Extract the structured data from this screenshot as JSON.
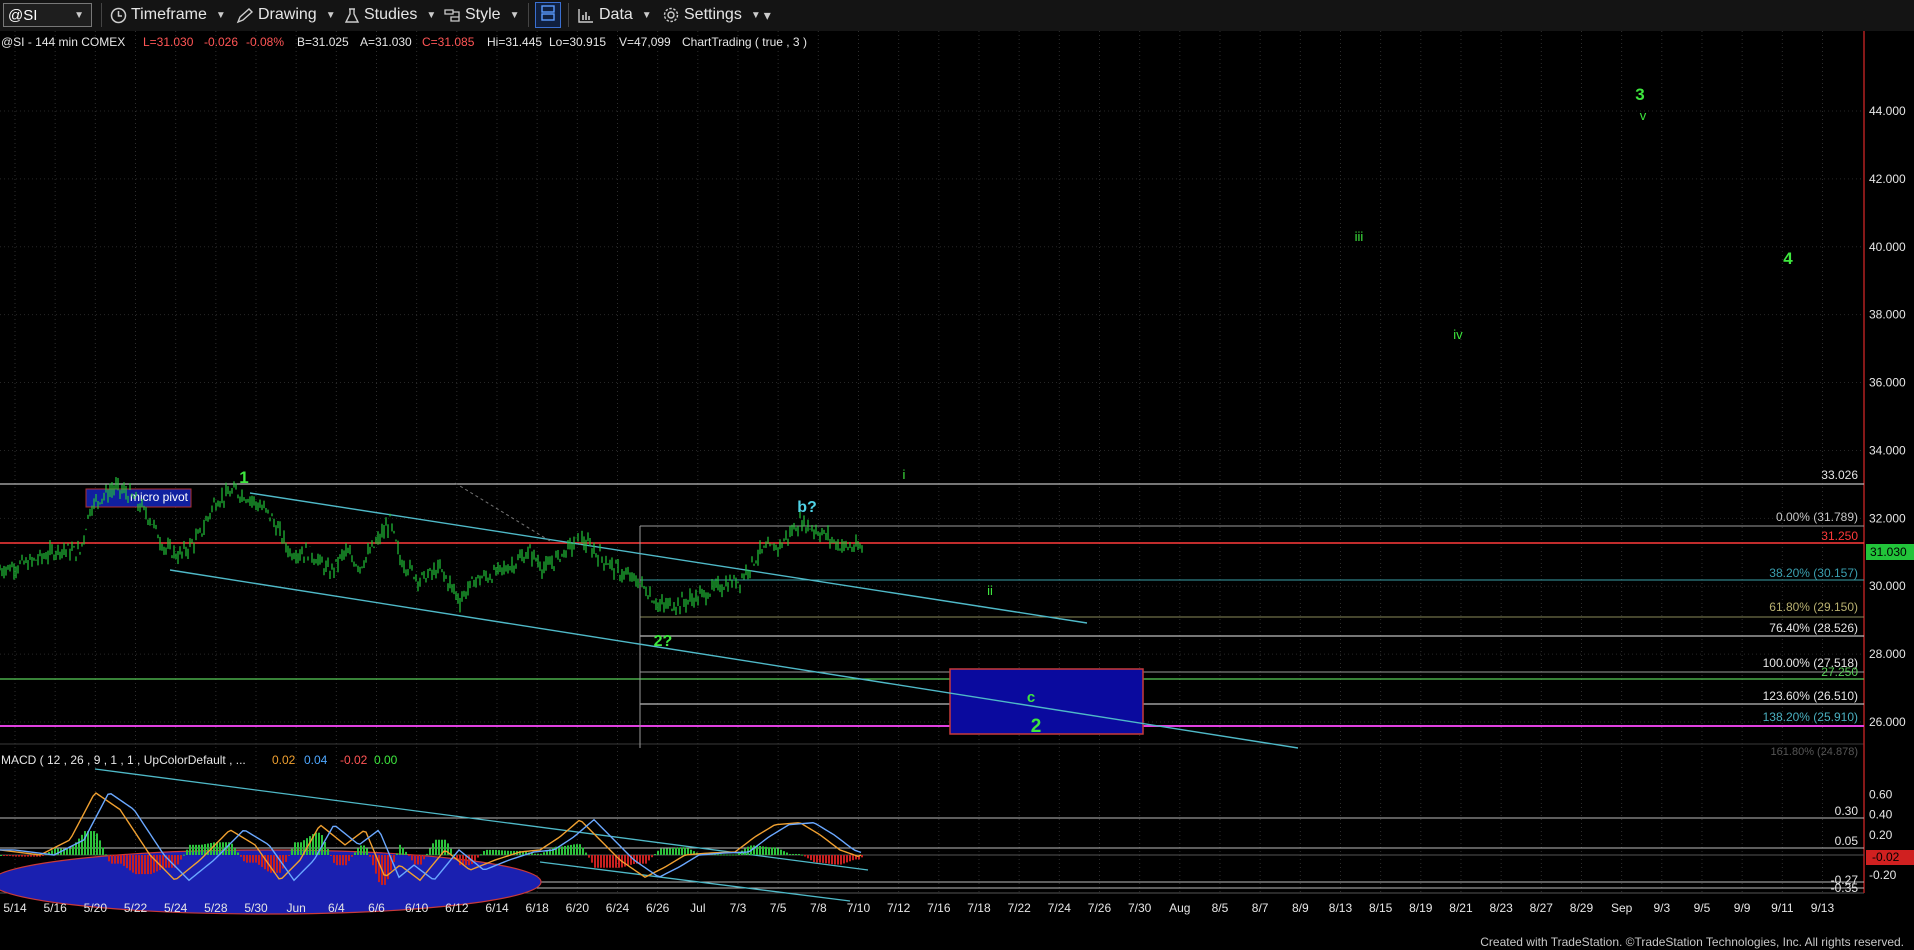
{
  "toolbar": {
    "symbol": "@SI",
    "timeframe_label": "Timeframe",
    "drawing_label": "Drawing",
    "studies_label": "Studies",
    "style_label": "Style",
    "data_label": "Data",
    "settings_label": "Settings"
  },
  "info_line": {
    "symbol_desc": "@SI - 144 min  COMEX",
    "last": "L=31.030",
    "change": "-0.026",
    "change_pct": "-0.08%",
    "bid": "B=31.025",
    "ask": "A=31.030",
    "close": "C=31.085",
    "high": "Hi=31.445",
    "low": "Lo=30.915",
    "volume": "V=47,099",
    "charttrading": "ChartTrading ( true , 3 )"
  },
  "macd": {
    "label": "MACD ( 12 , 26 , 9 , 1 , 1 , UpColorDefault , ...",
    "v1": "0.02",
    "v2": "0.04",
    "v3": "-0.02",
    "v4": "0.00"
  },
  "price_axis": [
    "44.000",
    "42.000",
    "40.000",
    "38.000",
    "36.000",
    "34.000",
    "32.000",
    "30.000",
    "28.000",
    "26.000"
  ],
  "macd_axis": [
    "0.60",
    "0.40",
    "0.20",
    "-0.20"
  ],
  "date_labels": [
    "5/14",
    "5/16",
    "5/20",
    "5/22",
    "5/24",
    "5/28",
    "5/30",
    "Jun",
    "6/4",
    "6/6",
    "6/10",
    "6/12",
    "6/14",
    "6/18",
    "6/20",
    "6/24",
    "6/26",
    "Jul",
    "7/3",
    "7/5",
    "7/8",
    "7/10",
    "7/12",
    "7/16",
    "7/18",
    "7/22",
    "7/24",
    "7/26",
    "7/30",
    "Aug",
    "8/5",
    "8/7",
    "8/9",
    "8/13",
    "8/15",
    "8/19",
    "8/21",
    "8/23",
    "8/27",
    "8/29",
    "Sep",
    "9/3",
    "9/5",
    "9/9",
    "9/11",
    "9/13"
  ],
  "levels": {
    "top": "33.026",
    "fib_000": "0.00% (31.789)",
    "red_line": "31.250",
    "last_price": "31.030",
    "fib_382": "38.20% (30.157)",
    "fib_618": "61.80% (29.150)",
    "fib_764": "76.40% (28.526)",
    "fib_1000": "100.00% (27.518)",
    "green_line": "27.250",
    "fib_1236": "123.60% (26.510)",
    "fib_1382": "138.20% (25.910)",
    "fib_1618_partial": "161.80% (24.878)"
  },
  "macd_levels": {
    "l030": "0.30",
    "l005": "0.05",
    "last": "-0.02",
    "lm027": "-0.27",
    "lm035": "-0.35"
  },
  "annotations": {
    "micro_pivot": "micro pivot",
    "wave_1": "1",
    "wave_2q": "2?",
    "wave_bq": "b?",
    "wave_i": "i",
    "wave_ii": "ii",
    "wave_iii": "iii",
    "wave_iv": "iv",
    "wave_v": "v",
    "wave_3": "3",
    "wave_4": "4",
    "wave_c": "c",
    "wave_2": "2"
  },
  "footer": "Created with TradeStation. ©TradeStation Technologies, Inc. All rights reserved.",
  "colors": {
    "price": "#22c43a",
    "channel": "#4fb9c8",
    "red_line": "#ff3a3a",
    "magenta_line": "#e040e0",
    "green_line": "#5ad05a",
    "box_fill": "#0a0a9e",
    "box_border": "#c83a3a",
    "wave_green": "#3ee63e",
    "wave_cyan": "#4fd2e6",
    "grid": "#3a3a3a"
  }
}
